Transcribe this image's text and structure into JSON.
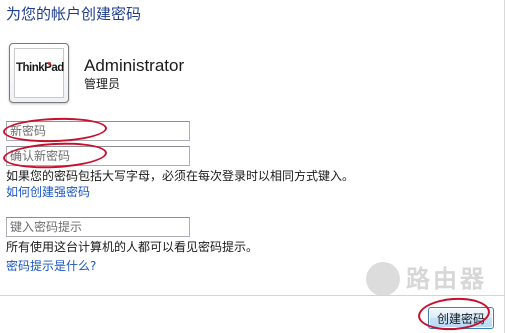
{
  "page": {
    "title": "为您的帐户创建密码"
  },
  "user": {
    "avatar_text": "ThinkPad",
    "name": "Administrator",
    "role": "管理员"
  },
  "form": {
    "new_password_placeholder": "新密码",
    "confirm_password_placeholder": "确认新密码",
    "policy_text": "如果您的密码包括大写字母，必须在每次登录时以相同方式键入。",
    "strong_password_link": "如何创建强密码",
    "hint_placeholder": "键入密码提示",
    "hint_visibility_text": "所有使用这台计算机的人都可以看见密码提示。",
    "hint_link": "密码提示是什么?"
  },
  "footer": {
    "create_button": "创建密码"
  },
  "watermark": {
    "text": "路由器"
  },
  "colors": {
    "title": "#1e3d8f",
    "link": "#1a56c8",
    "annotation": "#c8102e"
  }
}
